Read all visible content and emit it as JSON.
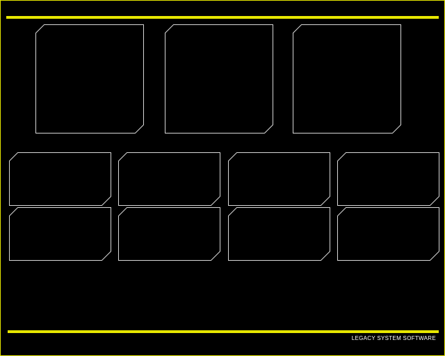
{
  "colors": {
    "background": "#000000",
    "accent": "#e6e600",
    "tile_outline": "#d8d8d8",
    "text": "#ffffff"
  },
  "footer": {
    "brand": "LEGACY SYSTEM SOFTWARE"
  }
}
